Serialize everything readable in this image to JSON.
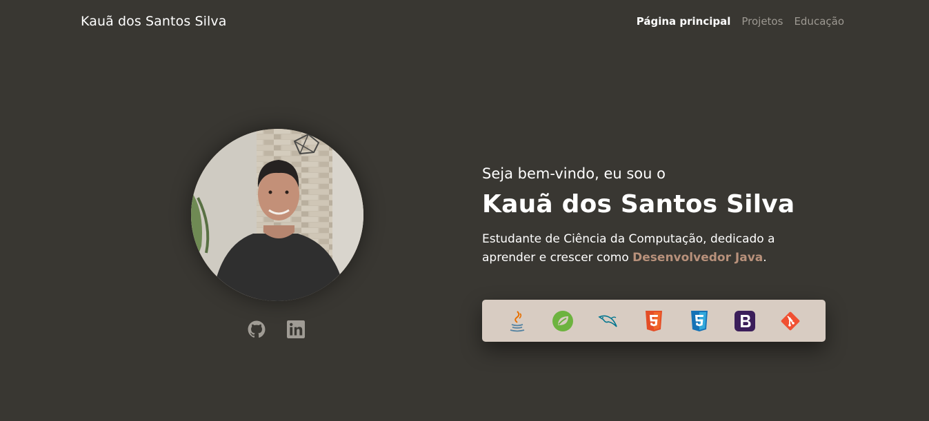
{
  "brand": "Kauã dos Santos Silva",
  "nav": {
    "items": [
      {
        "label": "Página principal",
        "active": true
      },
      {
        "label": "Projetos",
        "active": false
      },
      {
        "label": "Educação",
        "active": false
      }
    ]
  },
  "hero": {
    "greeting": "Seja bem-vindo, eu sou o",
    "name": "Kauã dos Santos Silva",
    "description_before": "Estudante de Ciência da Computação, dedicado a aprender e crescer como ",
    "description_highlight": "Desenvolvedor Java",
    "description_after": "."
  },
  "social": [
    {
      "icon": "github-icon"
    },
    {
      "icon": "linkedin-icon"
    }
  ],
  "skills": [
    {
      "icon": "java-icon",
      "color": "#5382a1"
    },
    {
      "icon": "spring-icon",
      "color": "#6db33f"
    },
    {
      "icon": "mysql-icon",
      "color": "#00758f"
    },
    {
      "icon": "html5-icon",
      "color": "#e44d26"
    },
    {
      "icon": "css3-icon",
      "color": "#1572b6"
    },
    {
      "icon": "bootstrap-icon",
      "color": "#563d7c"
    },
    {
      "icon": "git-icon",
      "color": "#f05032"
    }
  ],
  "colors": {
    "background": "#393732",
    "accent": "#b8917b",
    "skills_bar": "#d8ccc2",
    "nav_inactive": "#9d9992"
  }
}
